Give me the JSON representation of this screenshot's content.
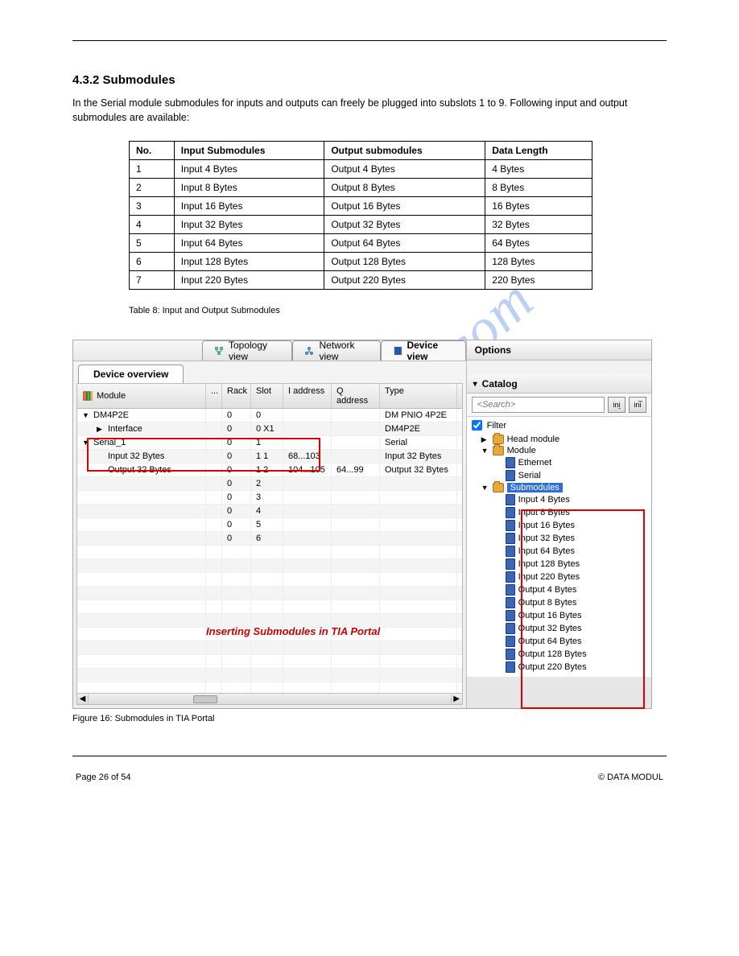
{
  "watermark": "manualshive.com",
  "section_title": "4.3.2 Submodules",
  "section_para": "In the Serial module submodules for inputs and outputs can freely be plugged into subslots 1 to 9. Following input and output submodules are available:",
  "slot_table": {
    "headers": [
      "No.",
      "Input Submodules",
      "Output submodules",
      "Data Length"
    ],
    "rows": [
      [
        "1",
        "Input 4 Bytes",
        "Output 4 Bytes",
        "4 Bytes"
      ],
      [
        "2",
        "Input 8 Bytes",
        "Output 8 Bytes",
        "8 Bytes"
      ],
      [
        "3",
        "Input 16 Bytes",
        "Output 16 Bytes",
        "16 Bytes"
      ],
      [
        "4",
        "Input 32 Bytes",
        "Output 32 Bytes",
        "32 Bytes"
      ],
      [
        "5",
        "Input 64 Bytes",
        "Output 64 Bytes",
        "64 Bytes"
      ],
      [
        "6",
        "Input 128 Bytes",
        "Output 128 Bytes",
        "128 Bytes"
      ],
      [
        "7",
        "Input 220 Bytes",
        "Output 220 Bytes",
        "220 Bytes"
      ]
    ],
    "caption": "Table 8: Input and Output Submodules"
  },
  "top_tabs": {
    "topology": "Topology view",
    "network": "Network view",
    "device": "Device view"
  },
  "dev_overview": {
    "tab": "Device overview",
    "head": {
      "module": "Module",
      "dots": "...",
      "rack": "Rack",
      "slot": "Slot",
      "iaddr": "I address",
      "qaddr": "Q address",
      "type": "Type"
    },
    "rows": [
      {
        "mod": "DM4P2E",
        "indent": 0,
        "tog": "▼",
        "rack": "0",
        "slot": "0",
        "i": "",
        "q": "",
        "type": "DM PNIO 4P2E"
      },
      {
        "mod": "Interface",
        "indent": 1,
        "tog": "▶",
        "rack": "0",
        "slot": "0 X1",
        "i": "",
        "q": "",
        "type": "DM4P2E"
      },
      {
        "mod": "Serial_1",
        "indent": 0,
        "tog": "▼",
        "rack": "0",
        "slot": "1",
        "i": "",
        "q": "",
        "type": "Serial"
      },
      {
        "mod": "Input  32 Bytes",
        "indent": 1,
        "tog": "",
        "rack": "0",
        "slot": "1 1",
        "i": "68...103",
        "q": "",
        "type": "Input  32 Bytes"
      },
      {
        "mod": "Output  32 Bytes",
        "indent": 1,
        "tog": "",
        "rack": "0",
        "slot": "1 2",
        "i": "104...105",
        "q": "64...99",
        "type": "Output  32 Bytes"
      },
      {
        "mod": "",
        "indent": 1,
        "tog": "",
        "rack": "0",
        "slot": "2",
        "i": "",
        "q": "",
        "type": ""
      },
      {
        "mod": "",
        "indent": 1,
        "tog": "",
        "rack": "0",
        "slot": "3",
        "i": "",
        "q": "",
        "type": ""
      },
      {
        "mod": "",
        "indent": 1,
        "tog": "",
        "rack": "0",
        "slot": "4",
        "i": "",
        "q": "",
        "type": ""
      },
      {
        "mod": "",
        "indent": 1,
        "tog": "",
        "rack": "0",
        "slot": "5",
        "i": "",
        "q": "",
        "type": ""
      },
      {
        "mod": "",
        "indent": 1,
        "tog": "",
        "rack": "0",
        "slot": "6",
        "i": "",
        "q": "",
        "type": ""
      }
    ],
    "caption_red": "Inserting Submodules in TIA Portal"
  },
  "options": {
    "title": "Options",
    "catalog": {
      "title": "Catalog",
      "search_placeholder": "<Search>",
      "filter_label": "Filter",
      "items": [
        {
          "label": "Head module",
          "type": "folder",
          "tog": "▶",
          "depth": 0
        },
        {
          "label": "Module",
          "type": "folder",
          "tog": "▼",
          "depth": 0
        },
        {
          "label": "Ethernet",
          "type": "chip",
          "tog": "",
          "depth": 1
        },
        {
          "label": "Serial",
          "type": "chip",
          "tog": "",
          "depth": 1
        },
        {
          "label": "Submodules",
          "type": "folder-sel",
          "tog": "▼",
          "depth": 0
        },
        {
          "label": "Input   4 Bytes",
          "type": "chip",
          "tog": "",
          "depth": 1
        },
        {
          "label": "Input   8 Bytes",
          "type": "chip",
          "tog": "",
          "depth": 1
        },
        {
          "label": "Input  16 Bytes",
          "type": "chip",
          "tog": "",
          "depth": 1
        },
        {
          "label": "Input  32 Bytes",
          "type": "chip",
          "tog": "",
          "depth": 1
        },
        {
          "label": "Input  64 Bytes",
          "type": "chip",
          "tog": "",
          "depth": 1
        },
        {
          "label": "Input 128 Bytes",
          "type": "chip",
          "tog": "",
          "depth": 1
        },
        {
          "label": "Input 220 Bytes",
          "type": "chip",
          "tog": "",
          "depth": 1
        },
        {
          "label": "Output   4 Bytes",
          "type": "chip",
          "tog": "",
          "depth": 1
        },
        {
          "label": "Output   8 Bytes",
          "type": "chip",
          "tog": "",
          "depth": 1
        },
        {
          "label": "Output  16 Bytes",
          "type": "chip",
          "tog": "",
          "depth": 1
        },
        {
          "label": "Output  32 Bytes",
          "type": "chip",
          "tog": "",
          "depth": 1
        },
        {
          "label": "Output  64 Bytes",
          "type": "chip",
          "tog": "",
          "depth": 1
        },
        {
          "label": "Output 128 Bytes",
          "type": "chip",
          "tog": "",
          "depth": 1
        },
        {
          "label": "Output 220 Bytes",
          "type": "chip",
          "tog": "",
          "depth": 1
        }
      ]
    }
  },
  "fig_caption": "Figure 16: Submodules in TIA Portal",
  "footer": {
    "left": "Page 26 of 54",
    "right": "© DATA MODUL"
  }
}
